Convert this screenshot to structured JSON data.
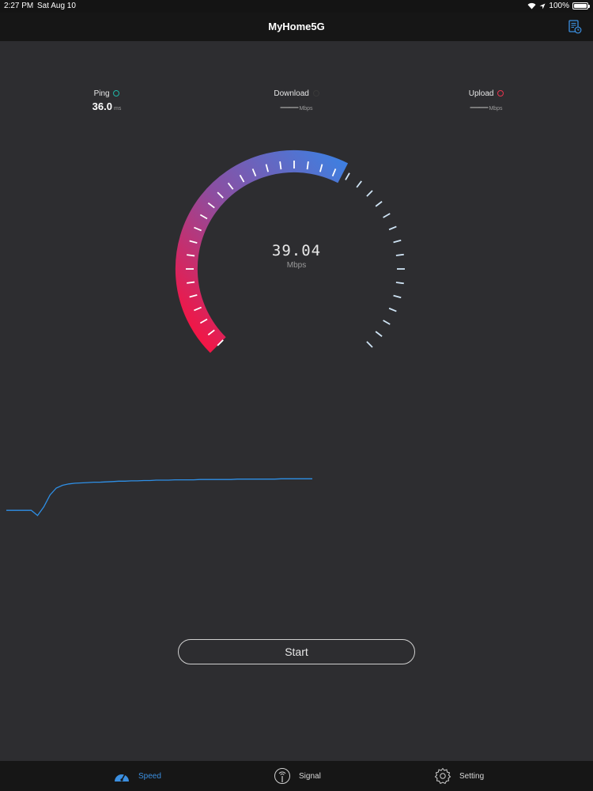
{
  "status_bar": {
    "time": "2:27 PM",
    "date": "Sat Aug 10",
    "battery": "100%"
  },
  "header": {
    "title": "MyHome5G",
    "history_icon": "history-icon"
  },
  "metrics": {
    "ping": {
      "label": "Ping",
      "value": "36.0",
      "unit": "ms",
      "color": "#1fb5a6"
    },
    "download": {
      "label": "Download",
      "value": "——",
      "unit": "Mbps",
      "color": "#3a3a3a"
    },
    "upload": {
      "label": "Upload",
      "value": "——",
      "unit": "Mbps",
      "color": "#e8334e"
    }
  },
  "gauge": {
    "value": "39.04",
    "unit": "Mbps",
    "level_fraction": 0.6,
    "colors": {
      "low": "#ff0f3a",
      "mid": "#8c4ea1",
      "high": "#3f7fe0",
      "tick_inactive": "#cfe4f5"
    }
  },
  "chart_data": {
    "type": "line",
    "title": "",
    "xlabel": "",
    "ylabel": "",
    "grid": false,
    "series": [
      {
        "values": [
          0.05,
          0.05,
          0.05,
          0.05,
          0.05,
          -0.1,
          0.15,
          0.5,
          0.7,
          0.78,
          0.82,
          0.84,
          0.85,
          0.86,
          0.87,
          0.87,
          0.88,
          0.89,
          0.9,
          0.9,
          0.91,
          0.91,
          0.92,
          0.92,
          0.93,
          0.93,
          0.93,
          0.94,
          0.94,
          0.94,
          0.94,
          0.95,
          0.95,
          0.95,
          0.95,
          0.95,
          0.95,
          0.96,
          0.96,
          0.96,
          0.96,
          0.96,
          0.96,
          0.96,
          0.97,
          0.97,
          0.97,
          0.97,
          0.97,
          0.97
        ]
      }
    ],
    "ylim": [
      -0.2,
      1.0
    ],
    "color": "#2e8fe6"
  },
  "start_button": {
    "label": "Start"
  },
  "tabs": [
    {
      "label": "Speed",
      "icon": "speedometer-icon",
      "active": true
    },
    {
      "label": "Signal",
      "icon": "signal-icon",
      "active": false
    },
    {
      "label": "Setting",
      "icon": "gear-icon",
      "active": false
    }
  ]
}
